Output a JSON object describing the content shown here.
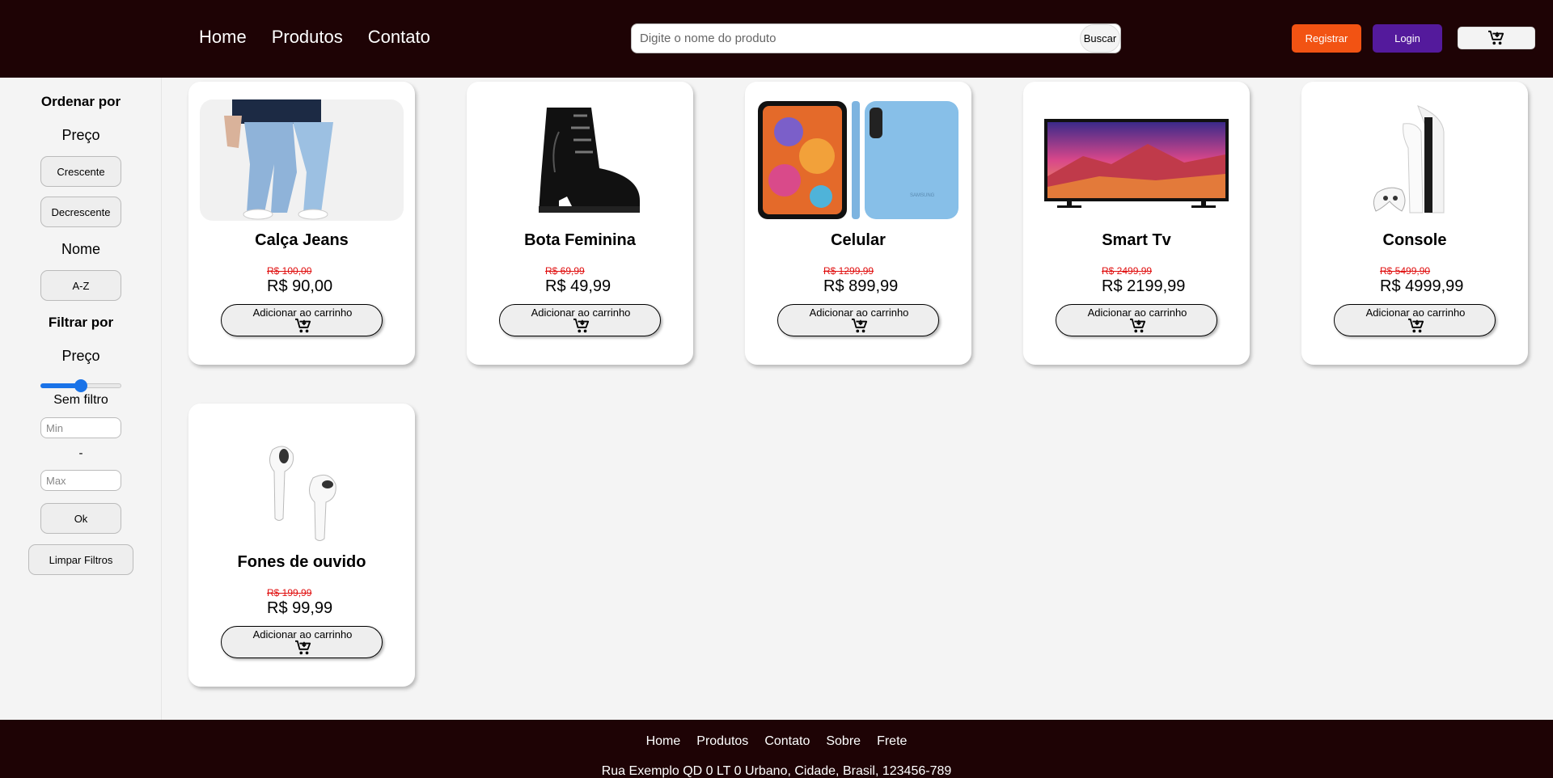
{
  "header": {
    "nav": [
      "Home",
      "Produtos",
      "Contato"
    ],
    "search_placeholder": "Digite o nome do produto",
    "search_button": "Buscar",
    "register_button": "Registrar",
    "login_button": "Login",
    "cart_icon": "cart-icon"
  },
  "sidebar": {
    "sort_title": "Ordenar por",
    "price_label": "Preço",
    "asc_button": "Crescente",
    "desc_button": "Decrescente",
    "name_label": "Nome",
    "az_button": "A-Z",
    "filter_title": "Filtrar por",
    "filter_price_label": "Preço",
    "slider_value": 0.5,
    "filter_status": "Sem filtro",
    "min_placeholder": "Min",
    "separator": "-",
    "max_placeholder": "Max",
    "ok_button": "Ok",
    "clear_button": "Limpar Filtros"
  },
  "products": [
    {
      "name": "Calça Jeans",
      "old_price": "R$ 100,00",
      "price": "R$ 90,00",
      "button": "Adicionar ao carrinho",
      "image": "jeans-image"
    },
    {
      "name": "Bota Feminina",
      "old_price": "R$ 69,99",
      "price": "R$ 49,99",
      "button": "Adicionar ao carrinho",
      "image": "boot-image"
    },
    {
      "name": "Celular",
      "old_price": "R$ 1299,99",
      "price": "R$ 899,99",
      "button": "Adicionar ao carrinho",
      "image": "phone-image"
    },
    {
      "name": "Smart Tv",
      "old_price": "R$ 2499,99",
      "price": "R$ 2199,99",
      "button": "Adicionar ao carrinho",
      "image": "tv-image"
    },
    {
      "name": "Console",
      "old_price": "R$ 5499,90",
      "price": "R$ 4999,99",
      "button": "Adicionar ao carrinho",
      "image": "console-image"
    },
    {
      "name": "Fones de ouvido",
      "old_price": "R$ 199,99",
      "price": "R$ 99,99",
      "button": "Adicionar ao carrinho",
      "image": "earbuds-image"
    }
  ],
  "footer": {
    "links": [
      "Home",
      "Produtos",
      "Contato",
      "Sobre",
      "Frete"
    ],
    "address": "Rua Exemplo QD 0 LT 0 Urbano, Cidade, Brasil, 123456-789"
  },
  "colors": {
    "header_bg": "#1e0305",
    "register": "#f25313",
    "login": "#541a9c",
    "old_price": "#e01010",
    "slider": "#1a73e8"
  }
}
